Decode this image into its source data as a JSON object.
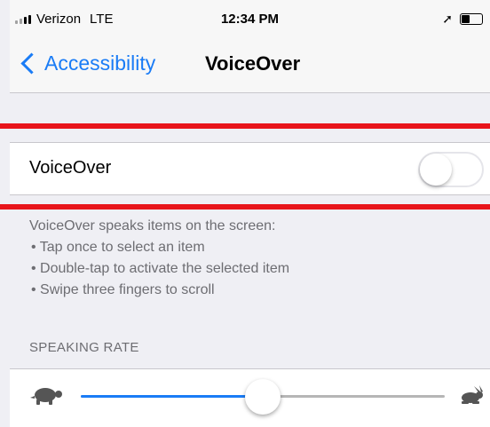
{
  "status_bar": {
    "carrier": "Verizon",
    "network": "LTE",
    "time": "12:34 PM",
    "location_icon": "location-arrow-icon",
    "battery_icon": "battery-icon"
  },
  "nav": {
    "back_label": "Accessibility",
    "title": "VoiceOver"
  },
  "voiceover_row": {
    "label": "VoiceOver",
    "toggle_on": false
  },
  "description": {
    "intro": "VoiceOver speaks items on the screen:",
    "bullets": [
      "• Tap once to select an item",
      "• Double-tap to activate the selected item",
      "• Swipe three fingers to scroll"
    ]
  },
  "speaking_rate": {
    "header": "SPEAKING RATE",
    "value": 0.5,
    "slow_icon": "turtle-icon",
    "fast_icon": "hare-icon"
  },
  "colors": {
    "accent": "#1a7cf6",
    "highlight": "#e8151b"
  }
}
